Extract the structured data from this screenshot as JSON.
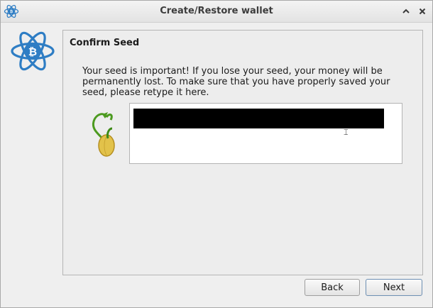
{
  "window": {
    "title": "Create/Restore wallet"
  },
  "titlebar": {
    "app_icon": "electrum-logo-icon",
    "collapse_icon": "chevron-up-icon",
    "close_icon": "close-icon"
  },
  "sidebar": {
    "logo_icon": "electrum-bitcoin-logo-icon"
  },
  "panel": {
    "heading": "Confirm Seed",
    "message": "Your seed is important! If you lose your seed, your money will be permanently lost. To make sure that you have properly saved your seed, please retype it here.",
    "seed_icon": "seed-sprout-icon",
    "seed_input": {
      "value": "[redacted]",
      "cursor": "text-cursor-icon"
    }
  },
  "buttons": {
    "back_label": "Back",
    "next_label": "Next"
  },
  "colors": {
    "accent": "#2f6fb7",
    "logo_blue": "#2e7dc4"
  }
}
